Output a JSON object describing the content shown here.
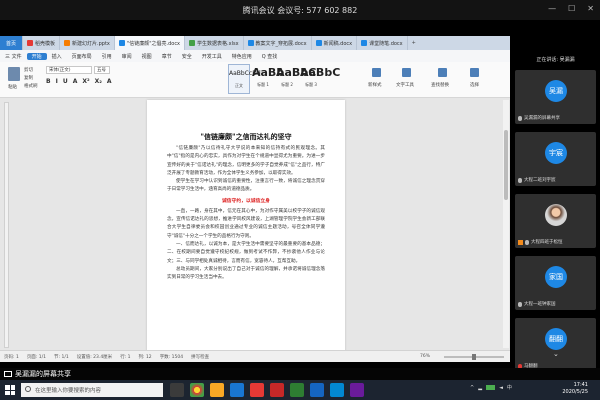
{
  "meeting": {
    "title": "腾讯会议 会议号: 577 602 882",
    "speaking_label": "正在讲话: 吴漏漏",
    "share_label": "吴漏漏的屏幕共享"
  },
  "wps": {
    "tabs": [
      {
        "label": "首页",
        "color": "#2e7fd1"
      },
      {
        "label": "稻壳模板",
        "color": "#e53935"
      },
      {
        "label": "新建幻灯片.pptx",
        "color": "#f57c00"
      },
      {
        "label": "\"信链廉颇\"之倡亮.docx",
        "color": "#1e88e5"
      },
      {
        "label": "学生数据表格.xlsx",
        "color": "#43a047"
      },
      {
        "label": "教案文字_穿拓展.docx",
        "color": "#1e88e5"
      },
      {
        "label": "新闻稿.docx",
        "color": "#1e88e5"
      },
      {
        "label": "课堂随笔.docx",
        "color": "#1e88e5"
      }
    ],
    "menu": [
      "三 文件",
      "开始",
      "插入",
      "页面布局",
      "引用",
      "审阅",
      "视图",
      "章节",
      "安全",
      "开发工具",
      "特色应用",
      "Q 查找"
    ],
    "ribbon": {
      "paste": "粘贴",
      "cut": "剪切",
      "copy": "复制",
      "format_painter": "格式刷",
      "font_name": "宋体(正文)",
      "font_size": "五号",
      "format_buttons": [
        "B",
        "I",
        "U",
        "A",
        "X²",
        "X₂",
        "A"
      ],
      "styles": [
        {
          "sample": "AaBbCcDd",
          "name": "正文"
        },
        {
          "sample": "AaBb",
          "name": "标题 1"
        },
        {
          "sample": "AaBbC",
          "name": "标题 2"
        },
        {
          "sample": "AaBbC",
          "name": "标题 3"
        }
      ],
      "find_replace": "查找替换",
      "select": "选择",
      "new_style": "新样式",
      "text_tools": "文字工具"
    },
    "document": {
      "title": "\"信链廉颇\"之信而达礼的坚守",
      "paragraphs": [
        "\"信链廉颇\"乃以信待礼守大学说的本来知的信持有式的民观理念。其中\"信\"指的是内心的忠实，具作为对学生在个规道中显得尤为重要。为进一步宣传好的关于\"信诺达礼\"的理念，信明更多的学子自觉养成\"信\"之品行，特广泛开展了专题教育活动，作为全体学生义务参加，以取得实效。",
        "使学生在学习中认识到诚信的重要性，注重言行一致，将诚信之理念贯穿于日常学习生活中，涵育高尚的道德品质。"
      ],
      "subtitle": "诚信守约，以诚信立身",
      "paragraphs2": [
        "一直，一路，身在其中，信元在其心中，为对作守属美以校学子的诚信观念，宣传信诺达礼的思想，推进学风校风建设，上湖管理学院学生会新工部联合大学生自律委员会和校园创业通过专业的诚信主题活动，号召全体同学遵守\"诚信\"十分之一个学生的品格行为守则。",
        "一、信而达礼，以诚为本，是大学生活中需要坚守的最重要的基本品德；二、在校期间要自觉遵守校纪校规，做到考试不作弊，不抄袭他人作业与论文；三、与同学相处真诚相待，言而有信，宽容待人，互帮互助。",
        "总动员期间，大家分别说出了自己对于诚信的理解，并承诺将诚信理念落实到日常的学习生活当中去。"
      ]
    },
    "status": {
      "page": "页码: 1",
      "pages": "页面: 1/1",
      "section": "节: 1/1",
      "setting": "设置值: 23.4厘米",
      "row": "行: 1",
      "col": "列: 12",
      "words": "字数: 1504",
      "spell": "拼写检查",
      "zoom": "76%"
    }
  },
  "participants": [
    {
      "avatar": "吴漏",
      "name": "吴漏漏的屏幕共享",
      "mic": "on",
      "badge": false,
      "color": "#1e88e5"
    },
    {
      "avatar": "宇宸",
      "name": "大程二班刘宇宸",
      "mic": "on",
      "badge": false,
      "color": "#1e88e5"
    },
    {
      "avatar": "",
      "name": "大程四班于松恒",
      "mic": "on",
      "badge": true,
      "color": "#d6d6d6"
    },
    {
      "avatar": "家国",
      "name": "大程一班钟家国",
      "mic": "on",
      "badge": false,
      "color": "#1e88e5"
    },
    {
      "avatar": "翻翻",
      "name": "马翻翻",
      "mic": "muted",
      "badge": false,
      "color": "#1e88e5"
    }
  ],
  "taskbar": {
    "search_placeholder": "在这里输入你要搜索的内容",
    "time": "17:41",
    "date": "2020/5/25",
    "lang": "中"
  }
}
